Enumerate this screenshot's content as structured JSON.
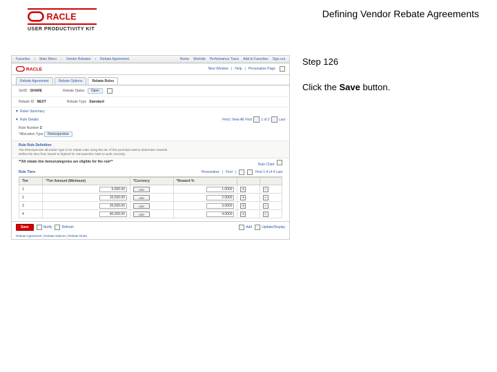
{
  "header": {
    "brand_sub": "USER PRODUCTIVITY KIT",
    "lesson_title": "Defining Vendor Rebate Agreements"
  },
  "side": {
    "step": "Step 126",
    "instr_pre": "Click the ",
    "instr_bold": "Save",
    "instr_post": " button."
  },
  "app": {
    "breadcrumb": [
      "Favorites",
      "Main Menu",
      "Vendor Rebates",
      "Rebate Agreement"
    ],
    "top_links": [
      "Home",
      "Worklist",
      "Performance Trace",
      "Add to Favorites",
      "Sign out"
    ],
    "subheader_links": [
      "New Window",
      "Help",
      "Personalize Page"
    ],
    "tabs": [
      "Rebate Agreement",
      "Rebate Options",
      "Rebate Rules"
    ],
    "tabs_active": 2,
    "setid_label": "SetID",
    "setid_value": "SHARE",
    "rebate_id_label": "Rebate ID",
    "rebate_id_value": "NEXT",
    "rebate_status_label": "Rebate Status",
    "rebate_status_value": "Open",
    "rebate_type_label": "Rebate Type",
    "rebate_type_value": "Standard",
    "section_rules_sum": "Rules Summary",
    "section_rule_det": "Rule Details",
    "rule_number_label": "Rule Number",
    "rule_number_value": "2",
    "allocation_type_label": "*Allocation Type",
    "allocation_type_value": "Retrospective",
    "desc_title": "Rule Rule Definition",
    "desc_line1": "The Retrospective allocation type is for rebate rules using the tier of the purchase total to determine rewards.",
    "desc_line2": "Define the tiers from lowest to highest for retrospective rules to work correctly.",
    "note_text": "**All rebate line items/categories are eligible for the rule**",
    "nav_label": "Find | View All",
    "nav_first": "First",
    "nav_pos": "1 of 2",
    "nav_last": "Last",
    "chart_label": "Rule Chart",
    "grid_title": "Rule Tiers",
    "grid_links": [
      "Personalize",
      "Find"
    ],
    "grid_nav": "First   1-4 of 4   Last",
    "cols": [
      "Tier",
      "*Tier Amount (Minimum)",
      "*Currency",
      "*Reward %"
    ],
    "rows": [
      {
        "tier": "1",
        "amt": "5,000.00",
        "cur": "USD",
        "rew": "1.0000"
      },
      {
        "tier": "2",
        "amt": "10,000.00",
        "cur": "USD",
        "rew": "2.0000"
      },
      {
        "tier": "3",
        "amt": "20,000.00",
        "cur": "USD",
        "rew": "3.0000"
      },
      {
        "tier": "4",
        "amt": "40,000.00",
        "cur": "USD",
        "rew": "4.0000"
      }
    ],
    "save_label": "Save",
    "notify_label": "Notify",
    "refresh_label": "Refresh",
    "add_label": "Add",
    "update_label": "Update/Display",
    "footer": "Rebate Agreement | Rebate Options | Rebate Rules"
  }
}
